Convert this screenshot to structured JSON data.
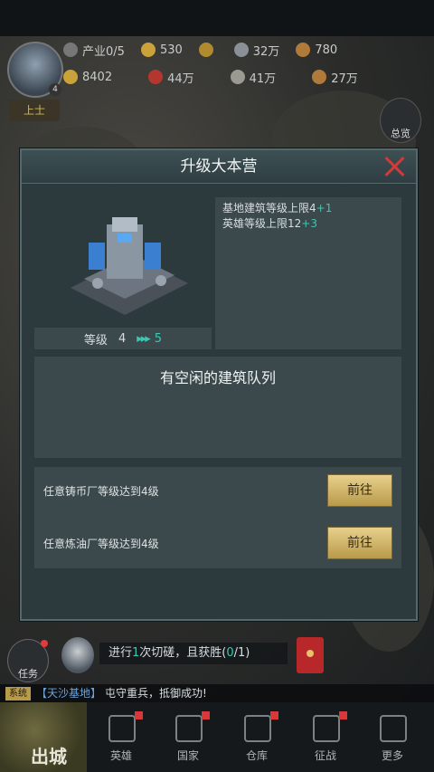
{
  "status_bar": {},
  "player": {
    "level": "4",
    "rank": "上士"
  },
  "resources": {
    "row1": [
      {
        "icon": "industry-icon",
        "value": "产业0/5"
      },
      {
        "icon": "gold-coin-icon",
        "value": "530"
      },
      {
        "icon": "add-icon",
        "value": ""
      },
      {
        "icon": "steel-icon",
        "value": "32万"
      },
      {
        "icon": "medal-icon",
        "value": "780"
      }
    ],
    "row2": [
      {
        "icon": "energy-icon",
        "value": "8402"
      },
      {
        "icon": "oil-icon",
        "value": "44万"
      },
      {
        "icon": "metal-icon",
        "value": "41万"
      },
      {
        "icon": "food-icon",
        "value": "27万"
      }
    ]
  },
  "overview_label": "总览",
  "dialog": {
    "title": "升级大本营",
    "level_label": "等级",
    "level_from": "4",
    "level_arrow": "▸▸▸",
    "level_to": "5",
    "bonuses": [
      {
        "text": "基地建筑等级上限4",
        "plus": "+1"
      },
      {
        "text": "英雄等级上限12",
        "plus": "+3"
      }
    ],
    "queue_text": "有空闲的建筑队列",
    "requirements": [
      {
        "text": "任意铸币厂等级达到4级",
        "button": "前往"
      },
      {
        "text": "任意炼油厂等级达到4级",
        "button": "前往"
      }
    ]
  },
  "quest": {
    "label": "任务",
    "text_pre": "进行",
    "text_hl": "1",
    "text_mid": "次切磋，且获胜(",
    "text_hl2": "0",
    "text_post": "/1)"
  },
  "system_message": {
    "tag": "系统",
    "name": "【天沙基地】",
    "text": "屯守重兵，抵御成功!"
  },
  "nav": {
    "sortie": "出城",
    "items": [
      {
        "label": "英雄",
        "icon": "hero-icon",
        "badge": true
      },
      {
        "label": "国家",
        "icon": "nation-icon",
        "badge": true
      },
      {
        "label": "仓库",
        "icon": "warehouse-icon",
        "badge": true
      },
      {
        "label": "征战",
        "icon": "battle-icon",
        "badge": true
      },
      {
        "label": "更多",
        "icon": "more-icon",
        "badge": false
      }
    ]
  }
}
